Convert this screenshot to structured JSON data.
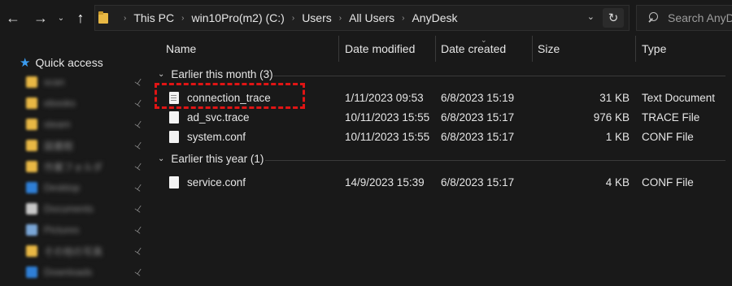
{
  "nav": {
    "back_glyph": "←",
    "forward_glyph": "→",
    "recent_glyph": "⌄",
    "up_glyph": "↑"
  },
  "address": {
    "crumbs": [
      "This PC",
      "win10Pro(m2) (C:)",
      "Users",
      "All Users",
      "AnyDesk"
    ],
    "separator": "›",
    "dropdown_glyph": "⌄",
    "refresh_glyph": "↻"
  },
  "search": {
    "placeholder": "Search AnyDesk"
  },
  "sidebar": {
    "quick_access_label": "Quick access",
    "pin_glyph": "📌",
    "blurred_items": [
      {
        "label": "scan",
        "icon_color": "#e8b844"
      },
      {
        "label": "ebooks",
        "icon_color": "#e8b844"
      },
      {
        "label": "steam",
        "icon_color": "#e8b844"
      },
      {
        "label": "図書館",
        "icon_color": "#e8b844"
      },
      {
        "label": "作業フォルダ",
        "icon_color": "#e8b844"
      },
      {
        "label": "Desktop",
        "icon_color": "#2f7fd6"
      },
      {
        "label": "Documents",
        "icon_color": "#c8c8c8"
      },
      {
        "label": "Pictures",
        "icon_color": "#7aa6d6"
      },
      {
        "label": "その他の写真",
        "icon_color": "#e8b844"
      },
      {
        "label": "Downloads",
        "icon_color": "#2f7fd6"
      }
    ]
  },
  "columns": {
    "name": "Name",
    "date_modified": "Date modified",
    "date_created": "Date created",
    "size": "Size",
    "type": "Type",
    "sort_glyph": "⌄"
  },
  "groups": [
    {
      "title": "Earlier this month (3)",
      "chevron": "⌄",
      "files": [
        {
          "name": "connection_trace",
          "modified": "1/11/2023 09:53",
          "created": "6/8/2023 15:19",
          "size": "31 KB",
          "type": "Text Document"
        },
        {
          "name": "ad_svc.trace",
          "modified": "10/11/2023 15:55",
          "created": "6/8/2023 15:17",
          "size": "976 KB",
          "type": "TRACE File"
        },
        {
          "name": "system.conf",
          "modified": "10/11/2023 15:55",
          "created": "6/8/2023 15:17",
          "size": "1 KB",
          "type": "CONF File"
        }
      ]
    },
    {
      "title": "Earlier this year (1)",
      "chevron": "⌄",
      "files": [
        {
          "name": "service.conf",
          "modified": "14/9/2023 15:39",
          "created": "6/8/2023 15:17",
          "size": "4 KB",
          "type": "CONF File"
        }
      ]
    }
  ],
  "colors": {
    "background": "#191919",
    "highlight": "#e01414",
    "quick_access_star": "#3b9cf0"
  }
}
